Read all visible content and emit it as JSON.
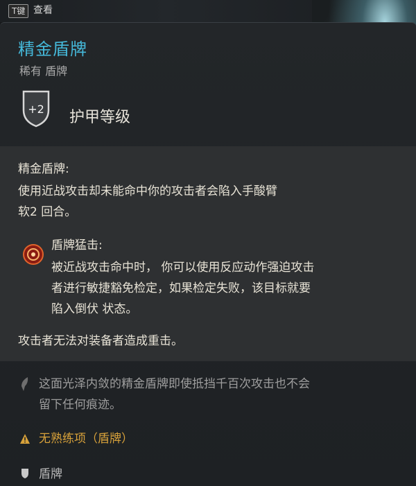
{
  "hint": {
    "key": "T键",
    "label": "查看"
  },
  "item": {
    "name": "精金盾牌",
    "subtitle": "稀有 盾牌",
    "armor_badge": "+2",
    "armor_label": "护甲等级"
  },
  "description": {
    "heading": "精金盾牌:",
    "line1": "使用近战攻击却未能命中你的攻击者会陷入手酸臂",
    "line2": "软2 回合。"
  },
  "ability": {
    "icon": "shield-bash-icon",
    "name": "盾牌猛击:",
    "line1": "被近战攻击命中时， 你可以使用反应动作强迫攻击",
    "line2": "者进行敏捷豁免检定，如果检定失败，该目标就要",
    "line3": "陷入倒伏 状态。"
  },
  "passive": {
    "text": "攻击者无法对装备者造成重击。"
  },
  "flavor": {
    "icon": "quill-icon",
    "line1": "这面光泽内敛的精金盾牌即使抵挡千百次攻击也不会",
    "line2": "留下任何痕迹。"
  },
  "proficiency": {
    "icon": "warning-icon",
    "text": "无熟练项（盾牌）"
  },
  "item_type": {
    "icon": "shield-icon",
    "text": "盾牌"
  },
  "colors": {
    "title": "#45b8d9",
    "warning": "#d8a23a",
    "text": "#e8e3d6"
  }
}
